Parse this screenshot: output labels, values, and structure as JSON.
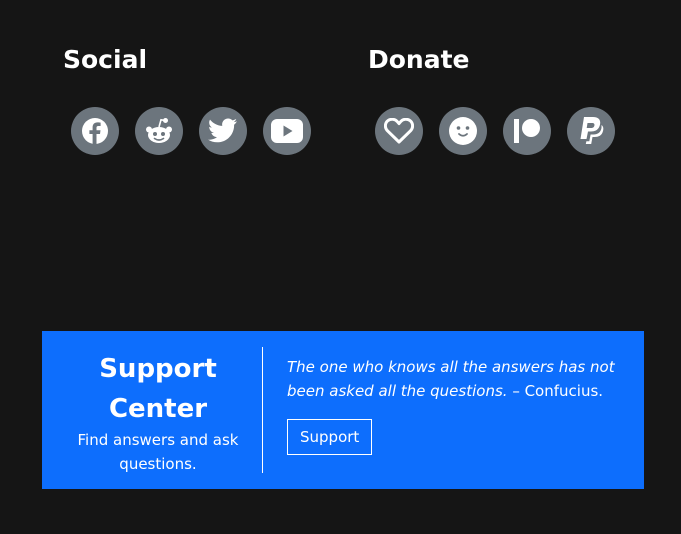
{
  "social": {
    "title": "Social",
    "links": [
      {
        "icon": "facebook-icon"
      },
      {
        "icon": "reddit-icon"
      },
      {
        "icon": "twitter-icon"
      },
      {
        "icon": "youtube-icon"
      }
    ]
  },
  "donate": {
    "title": "Donate",
    "links": [
      {
        "icon": "heart-icon"
      },
      {
        "icon": "smile-icon"
      },
      {
        "icon": "patreon-icon"
      },
      {
        "icon": "paypal-icon"
      }
    ]
  },
  "support": {
    "title": "Support Center",
    "subtitle": "Find answers and ask questions.",
    "quote": "The one who knows all the answers has not been asked all the questions.",
    "attribution": " – Confucius.",
    "button_label": "Support"
  },
  "colors": {
    "background": "#151515",
    "icon_circle": "#6c757d",
    "card": "#0d6efd",
    "text": "#ffffff"
  }
}
